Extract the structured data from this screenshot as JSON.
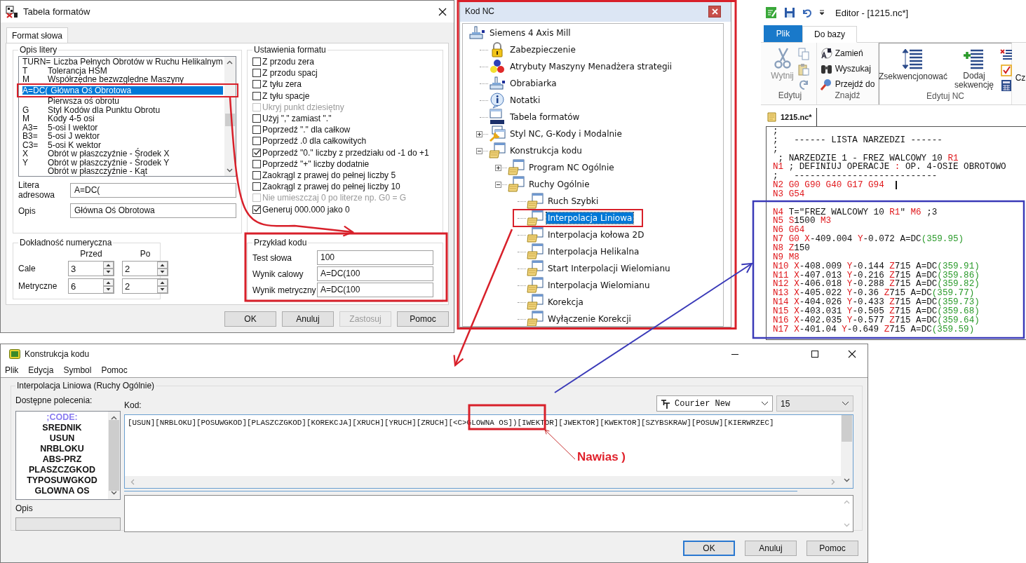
{
  "format_table": {
    "title": "Tabela formatów",
    "tabs": [
      {
        "label": "Format słowa",
        "selected": true
      }
    ],
    "letter_group": "Opis litery",
    "letters": [
      {
        "letter": "TURN=",
        "description": "Liczba Pełnych Obrotów w Ruchu Helikalnym",
        "selected": false
      },
      {
        "letter": "T",
        "description": "Tolerancja HSM",
        "selected": false
      },
      {
        "letter": "M",
        "description": "Współrzędne bezwzględne Maszyny",
        "selected": false
      },
      {
        "letter": "A=DC(",
        "description": "Główna Oś Obrotowa",
        "selected": true
      },
      {
        "description": "Pierwsza oś obrotu",
        "selected": false
      },
      {
        "letter": "G",
        "description": "Styl Kodów dla Punktu Obrotu",
        "selected": false
      },
      {
        "letter": "M",
        "description": "Kody 4-5 osi",
        "selected": false
      },
      {
        "letter": "A3=",
        "description": "5-osi I wektor",
        "selected": false
      },
      {
        "letter": "B3=",
        "description": "5-osi J wektor",
        "selected": false
      },
      {
        "letter": "C3=",
        "description": "5-osi K wektor",
        "selected": false
      },
      {
        "letter": "X",
        "description": "Obrót w płaszczyźnie - Środek X",
        "selected": false
      },
      {
        "letter": "Y",
        "description": "Obrót w płaszczyźnie - Środek Y",
        "selected": false
      },
      {
        "description": "Obrót w płaszczyźnie - Kąt",
        "selected": false
      }
    ],
    "address_letter": {
      "label": "Litera adresowa",
      "value": "A=DC("
    },
    "description": {
      "label": "Opis",
      "value": "Główna Oś Obrotowa"
    },
    "precision": {
      "title": "Dokładność numeryczna",
      "columns": [
        "Przed",
        "Po"
      ],
      "rows": [
        {
          "label": "Cale",
          "values": [
            "3",
            "2"
          ]
        },
        {
          "label": "Metryczne",
          "values": [
            "6",
            "2"
          ]
        }
      ]
    },
    "format_settings": {
      "title": "Ustawienia formatu",
      "options": [
        {
          "label": "Z przodu zera",
          "checked": false,
          "disabled": false
        },
        {
          "label": "Z przodu spacj",
          "checked": false,
          "disabled": false
        },
        {
          "label": "Z tyłu zera",
          "checked": false,
          "disabled": false
        },
        {
          "label": "Z tyłu spacje",
          "checked": false,
          "disabled": false
        },
        {
          "label": "Ukryj punkt dziesiętny",
          "checked": false,
          "disabled": true
        },
        {
          "label": "Użyj \",\" zamiast \".\"",
          "checked": false,
          "disabled": false
        },
        {
          "label": "Poprzedź \".\" dla całkow",
          "checked": false,
          "disabled": false
        },
        {
          "label": "Poprzedź .0 dla całkowitych",
          "checked": false,
          "disabled": false
        },
        {
          "label": "Poprzedź \"0.\" liczby z przedziału od -1 do +1",
          "checked": true,
          "disabled": false
        },
        {
          "label": "Poprzedź \"+\" liczby dodatnie",
          "checked": false,
          "disabled": false
        },
        {
          "label": "Zaokrągl z prawej do pełnej liczby 5",
          "checked": false,
          "disabled": false
        },
        {
          "label": "Zaokrągl z prawej do pełnej liczby 10",
          "checked": false,
          "disabled": false
        },
        {
          "label": "Nie umieszczaj 0 po literze np. G0 = G",
          "checked": false,
          "disabled": true
        },
        {
          "label": "Generuj 000.000 jako 0",
          "checked": true,
          "disabled": false
        }
      ]
    },
    "code_example": {
      "title": "Przykład kodu",
      "fields": [
        {
          "label": "Test słowa",
          "value": "100"
        },
        {
          "label": "Wynik calowy",
          "value": "A=DC(100"
        },
        {
          "label": "Wynik metryczny",
          "value": "A=DC(100"
        }
      ]
    },
    "buttons": [
      {
        "label": "OK",
        "disabled": false
      },
      {
        "label": "Anuluj",
        "disabled": false
      },
      {
        "label": "Zastosuj",
        "disabled": true
      },
      {
        "label": "Pomoc",
        "disabled": false
      }
    ]
  },
  "nc_tree": {
    "title": "Kod NC",
    "items": [
      {
        "label": "Siemens 4 Axis Mill",
        "kind": "machine",
        "selected": false,
        "children": [
          {
            "label": "Zabezpieczenie",
            "kind": "lock",
            "selected": false
          },
          {
            "label": "Atrybuty Maszyny Menadżera strategii",
            "kind": "spheres",
            "selected": false
          },
          {
            "label": "Obrabiarka",
            "kind": "machine",
            "selected": false
          },
          {
            "label": "Notatki",
            "kind": "info",
            "selected": false
          },
          {
            "label": "Tabela formatów",
            "kind": "format",
            "selected": false
          },
          {
            "label": "Styl NC, G-Kody i Modalnie",
            "kind": "style",
            "selected": false,
            "expanded": false
          },
          {
            "label": "Konstrukcja kodu",
            "kind": "scroll",
            "selected": false,
            "expanded": true,
            "children": [
              {
                "label": "Program NC Ogólnie",
                "kind": "scroll",
                "selected": false,
                "expanded": false
              },
              {
                "label": "Ruchy Ogólnie",
                "kind": "scroll",
                "selected": false,
                "expanded": true,
                "children": [
                  {
                    "label": "Ruch Szybki",
                    "kind": "scroll",
                    "selected": false
                  },
                  {
                    "label": "Interpolacja Liniowa",
                    "kind": "scroll",
                    "selected": true
                  },
                  {
                    "label": "Interpolacja kołowa 2D",
                    "kind": "scroll",
                    "selected": false
                  },
                  {
                    "label": "Interpolacja Helikalna",
                    "kind": "scroll",
                    "selected": false
                  },
                  {
                    "label": "Start Interpolacji Wielomianu",
                    "kind": "scroll",
                    "selected": false
                  },
                  {
                    "label": "Interpolacja Wielomianu",
                    "kind": "scroll",
                    "selected": false
                  },
                  {
                    "label": "Korekcja",
                    "kind": "scroll",
                    "selected": false
                  },
                  {
                    "label": "Wyłączenie Korekcji",
                    "kind": "scroll",
                    "selected": false
                  }
                ]
              }
            ]
          }
        ]
      }
    ]
  },
  "editor": {
    "title": "Editor - [1215.nc*]",
    "ribbon_tabs": [
      {
        "label": "Plik",
        "kind": "file",
        "selected": false
      },
      {
        "label": "Do bazy",
        "kind": "tab",
        "selected": true
      }
    ],
    "groups": [
      {
        "label": "Edytuj",
        "kind": "edit",
        "buttons": [
          {
            "label": "Wytnij",
            "disabled": true
          }
        ]
      },
      {
        "label": "Znajdź",
        "kind": "find",
        "buttons": [
          {
            "label": "Zamień",
            "disabled": false
          },
          {
            "label": "Wyszukaj",
            "disabled": false
          },
          {
            "label": "Przejdź do",
            "disabled": false
          }
        ]
      },
      {
        "label": "Edytuj NC",
        "kind": "nc",
        "buttons": [
          {
            "label": "Zsekwencjonować",
            "disabled": false
          },
          {
            "label": "Dodaj sekwencję",
            "disabled": false
          }
        ]
      },
      {
        "kind": "cut",
        "buttons": [
          {
            "label": "Cz",
            "disabled": false
          }
        ]
      }
    ],
    "document_tab": "1215.nc*",
    "lines": [
      {
        "kind": "code",
        "segments": [
          {
            "text": ";",
            "kind": "plain"
          }
        ]
      },
      {
        "kind": "code",
        "segments": [
          {
            "text": ";   ------ LISTA NARZEDZI ------",
            "kind": "plain"
          }
        ]
      },
      {
        "kind": "code",
        "segments": [
          {
            "text": ";",
            "kind": "plain"
          }
        ]
      },
      {
        "kind": "code",
        "segments": [
          {
            "text": " ; NARZEDZIE 1 - FREZ WALCOWY 10 ",
            "kind": "plain"
          },
          {
            "text": "R1",
            "kind": "address"
          }
        ]
      },
      {
        "kind": "code",
        "segments": [
          {
            "text": "N1",
            "kind": "address"
          },
          {
            "text": " ; DEFINIUJ OPERACJE ",
            "kind": "plain"
          },
          {
            "text": ":",
            "kind": "address"
          },
          {
            "text": " OP. 4-OSIE OBROTOWO",
            "kind": "plain"
          }
        ]
      },
      {
        "kind": "code",
        "segments": [
          {
            "text": ";   ---------------------------",
            "kind": "plain"
          }
        ]
      },
      {
        "kind": "code",
        "cursor": true,
        "segments": [
          {
            "text": "N2 G0 G90 G40 G17 G94",
            "kind": "address"
          }
        ]
      },
      {
        "kind": "code",
        "segments": [
          {
            "text": "N3 G54",
            "kind": "address"
          }
        ]
      },
      {
        "kind": "blank"
      },
      {
        "kind": "code",
        "segments": [
          {
            "text": "N4",
            "kind": "address"
          },
          {
            "text": " T=\"FREZ WALCOWY 10 ",
            "kind": "plain"
          },
          {
            "text": "R1",
            "kind": "address"
          },
          {
            "text": "\" ",
            "kind": "plain"
          },
          {
            "text": "M6",
            "kind": "address"
          },
          {
            "text": " ;3",
            "kind": "plain"
          }
        ]
      },
      {
        "kind": "code",
        "segments": [
          {
            "text": "N5 S",
            "kind": "address"
          },
          {
            "text": "1500 ",
            "kind": "plain"
          },
          {
            "text": "M3",
            "kind": "address"
          }
        ]
      },
      {
        "kind": "code",
        "segments": [
          {
            "text": "N6 G64",
            "kind": "address"
          }
        ]
      },
      {
        "kind": "code",
        "segments": [
          {
            "text": "N7 G0 X",
            "kind": "address"
          },
          {
            "text": "-409.004 ",
            "kind": "plain"
          },
          {
            "text": "Y",
            "kind": "address"
          },
          {
            "text": "-0.072 A=DC",
            "kind": "plain"
          },
          {
            "text": "(359.95)",
            "kind": "value"
          }
        ]
      },
      {
        "kind": "code",
        "segments": [
          {
            "text": "N8 Z",
            "kind": "address"
          },
          {
            "text": "150",
            "kind": "plain"
          }
        ]
      },
      {
        "kind": "code",
        "segments": [
          {
            "text": "N9 M8",
            "kind": "address"
          }
        ]
      },
      {
        "kind": "code",
        "segments": [
          {
            "text": "N10 X",
            "kind": "address"
          },
          {
            "text": "-408.009 ",
            "kind": "plain"
          },
          {
            "text": "Y",
            "kind": "address"
          },
          {
            "text": "-0.144 ",
            "kind": "plain"
          },
          {
            "text": "Z",
            "kind": "address"
          },
          {
            "text": "715 A=DC",
            "kind": "plain"
          },
          {
            "text": "(359.91)",
            "kind": "value"
          }
        ]
      },
      {
        "kind": "code",
        "segments": [
          {
            "text": "N11 X",
            "kind": "address"
          },
          {
            "text": "-407.013 ",
            "kind": "plain"
          },
          {
            "text": "Y",
            "kind": "address"
          },
          {
            "text": "-0.216 ",
            "kind": "plain"
          },
          {
            "text": "Z",
            "kind": "address"
          },
          {
            "text": "715 A=DC",
            "kind": "plain"
          },
          {
            "text": "(359.86)",
            "kind": "value"
          }
        ]
      },
      {
        "kind": "code",
        "segments": [
          {
            "text": "N12 X",
            "kind": "address"
          },
          {
            "text": "-406.018 ",
            "kind": "plain"
          },
          {
            "text": "Y",
            "kind": "address"
          },
          {
            "text": "-0.288 ",
            "kind": "plain"
          },
          {
            "text": "Z",
            "kind": "address"
          },
          {
            "text": "715 A=DC",
            "kind": "plain"
          },
          {
            "text": "(359.82)",
            "kind": "value"
          }
        ]
      },
      {
        "kind": "code",
        "segments": [
          {
            "text": "N13 X",
            "kind": "address"
          },
          {
            "text": "-405.022 ",
            "kind": "plain"
          },
          {
            "text": "Y",
            "kind": "address"
          },
          {
            "text": "-0.36 ",
            "kind": "plain"
          },
          {
            "text": "Z",
            "kind": "address"
          },
          {
            "text": "715 A=DC",
            "kind": "plain"
          },
          {
            "text": "(359.77)",
            "kind": "value"
          }
        ]
      },
      {
        "kind": "code",
        "segments": [
          {
            "text": "N14 X",
            "kind": "address"
          },
          {
            "text": "-404.026 ",
            "kind": "plain"
          },
          {
            "text": "Y",
            "kind": "address"
          },
          {
            "text": "-0.433 ",
            "kind": "plain"
          },
          {
            "text": "Z",
            "kind": "address"
          },
          {
            "text": "715 A=DC",
            "kind": "plain"
          },
          {
            "text": "(359.73)",
            "kind": "value"
          }
        ]
      },
      {
        "kind": "code",
        "segments": [
          {
            "text": "N15 X",
            "kind": "address"
          },
          {
            "text": "-403.031 ",
            "kind": "plain"
          },
          {
            "text": "Y",
            "kind": "address"
          },
          {
            "text": "-0.505 ",
            "kind": "plain"
          },
          {
            "text": "Z",
            "kind": "address"
          },
          {
            "text": "715 A=DC",
            "kind": "plain"
          },
          {
            "text": "(359.68)",
            "kind": "value"
          }
        ]
      },
      {
        "kind": "code",
        "segments": [
          {
            "text": "N16 X",
            "kind": "address"
          },
          {
            "text": "-402.035 ",
            "kind": "plain"
          },
          {
            "text": "Y",
            "kind": "address"
          },
          {
            "text": "-0.577 ",
            "kind": "plain"
          },
          {
            "text": "Z",
            "kind": "address"
          },
          {
            "text": "715 A=DC",
            "kind": "plain"
          },
          {
            "text": "(359.64)",
            "kind": "value"
          }
        ]
      },
      {
        "kind": "code",
        "segments": [
          {
            "text": "N17 X",
            "kind": "address"
          },
          {
            "text": "-401.04 ",
            "kind": "plain"
          },
          {
            "text": "Y",
            "kind": "address"
          },
          {
            "text": "-0.649 ",
            "kind": "plain"
          },
          {
            "text": "Z",
            "kind": "address"
          },
          {
            "text": "715 A=DC",
            "kind": "plain"
          },
          {
            "text": "(359.59)",
            "kind": "value"
          }
        ]
      }
    ]
  },
  "code_builder": {
    "title": "Konstrukcja kodu",
    "menu": [
      "Plik",
      "Edycja",
      "Symbol",
      "Pomoc"
    ],
    "group_title": "Interpolacja Liniowa (Ruchy Ogólnie)",
    "commands_label": "Dostępne polecenia:",
    "commands": [
      {
        "label": ";CODE:",
        "color": "#8a7cf0"
      },
      {
        "label": "SREDNIK",
        "color": "#111111"
      },
      {
        "label": "USUN",
        "color": "#111111"
      },
      {
        "label": "NRBLOKU",
        "color": "#111111"
      },
      {
        "label": "ABS-PRZ",
        "color": "#111111"
      },
      {
        "label": "PLASZCZGKOD",
        "color": "#111111"
      },
      {
        "label": "TYPOSUWGKOD",
        "color": "#111111"
      },
      {
        "label": "GLOWNA OS",
        "color": "#111111"
      }
    ],
    "description_label": "Opis",
    "code_label": "Kod:",
    "code": "[USUN][NRBLOKU][POSUWGKOD][PLASZCZGKOD][KOREKCJA][XRUCH][YRUCH][ZRUCH][<C>GLOWNA OS])[IWEKTOR][JWEKTOR][KWEKTOR][SZYBSKRAW][POSUW][KIERWRZEC]",
    "font": "Courier New",
    "font_size": "15",
    "buttons": [
      {
        "label": "OK",
        "default": true
      },
      {
        "label": "Anuluj",
        "default": false
      },
      {
        "label": "Pomoc",
        "default": false
      }
    ]
  },
  "annotations": [
    {
      "text": "Nawias )"
    }
  ]
}
